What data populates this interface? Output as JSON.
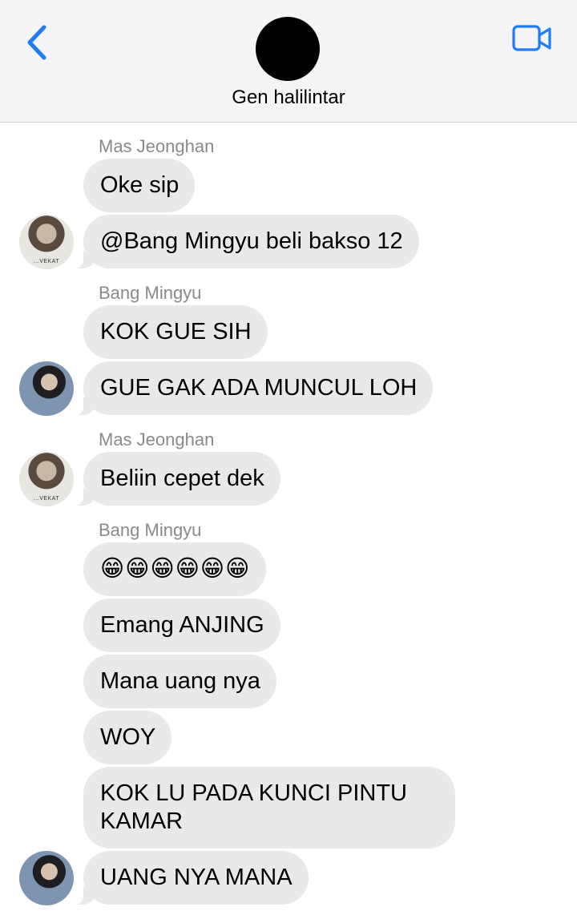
{
  "header": {
    "group_name": "Gen halilintar",
    "back_icon": "chevron-left-icon",
    "video_icon": "video-camera-icon",
    "accent_color": "#1f7bf6"
  },
  "senders": {
    "s1": "Mas Jeonghan",
    "s2": "Bang Mingyu",
    "s3": "Mas Jeonghan",
    "s4": "Bang Mingyu"
  },
  "avatar_text": {
    "shirt": "...VEKAT"
  },
  "messages": {
    "m1": "Oke sip",
    "m2": "@Bang Mingyu beli bakso 12",
    "m3": "KOK GUE SIH",
    "m4": "GUE GAK ADA MUNCUL LOH",
    "m5": "Beliin cepet dek",
    "m6": "😁😁😁😁😁😁",
    "m7": "Emang ANJING",
    "m8": "Mana uang nya",
    "m9": "WOY",
    "m10": "KOK LU PADA KUNCI PINTU KAMAR",
    "m11": "UANG NYA MANA"
  },
  "colors": {
    "bubble_received": "#e9e9eb",
    "header_bg": "#f5f5f7",
    "sender_label": "#8a8a8e"
  }
}
